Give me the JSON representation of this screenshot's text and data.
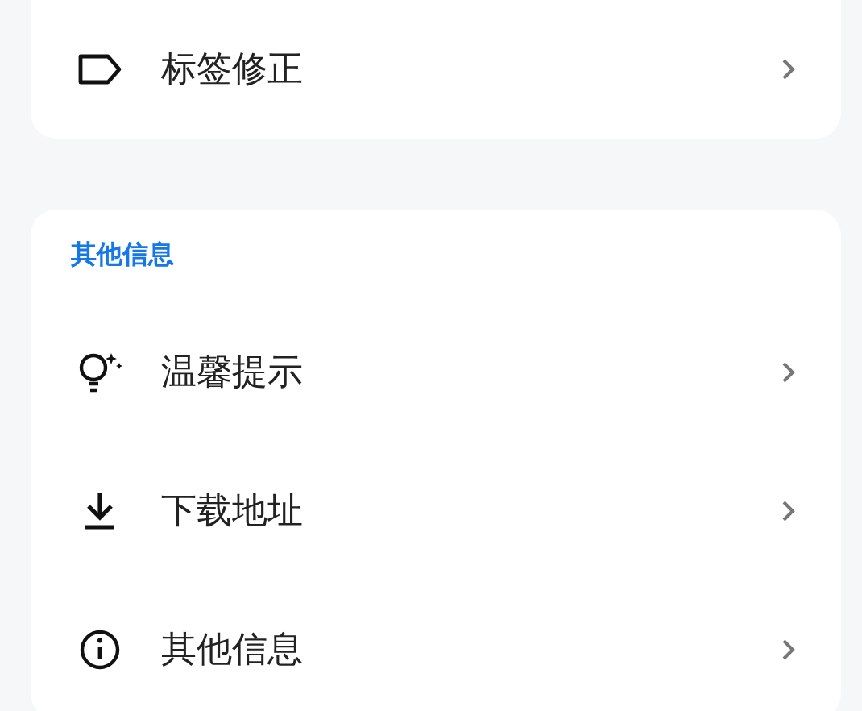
{
  "top_card": {
    "items": [
      {
        "kind": "tag",
        "label": "标签修正"
      }
    ]
  },
  "other_card": {
    "title": "其他信息",
    "items": [
      {
        "kind": "bulb",
        "label": "温馨提示"
      },
      {
        "kind": "download",
        "label": "下载地址"
      },
      {
        "kind": "info",
        "label": "其他信息"
      }
    ]
  }
}
